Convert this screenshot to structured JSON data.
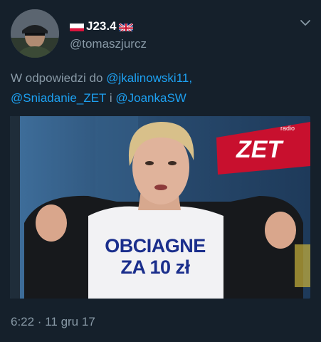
{
  "user": {
    "display_name": "J23.4",
    "handle": "@tomaszjurcz",
    "flag_left": "poland-flag-icon",
    "flag_right": "uk-flag-icon"
  },
  "reply": {
    "prefix": "W odpowiedzi do",
    "mention1": "@jkalinowski11",
    "sep1": ",",
    "mention2": "@Sniadanie_ZET",
    "conj": "i",
    "mention3": "@JoankaSW"
  },
  "media": {
    "logo_small": "radio",
    "logo_big": "ZET",
    "shirt_line1": "OBCIAGNE",
    "shirt_line2": "ZA 10 zł"
  },
  "timestamp": "6:22 · 11 gru 17",
  "colors": {
    "background": "#15202b",
    "secondary_text": "#8899a6",
    "link": "#1da1f2",
    "zet_red": "#c8102e",
    "shirt_text": "#1a2e8c"
  }
}
